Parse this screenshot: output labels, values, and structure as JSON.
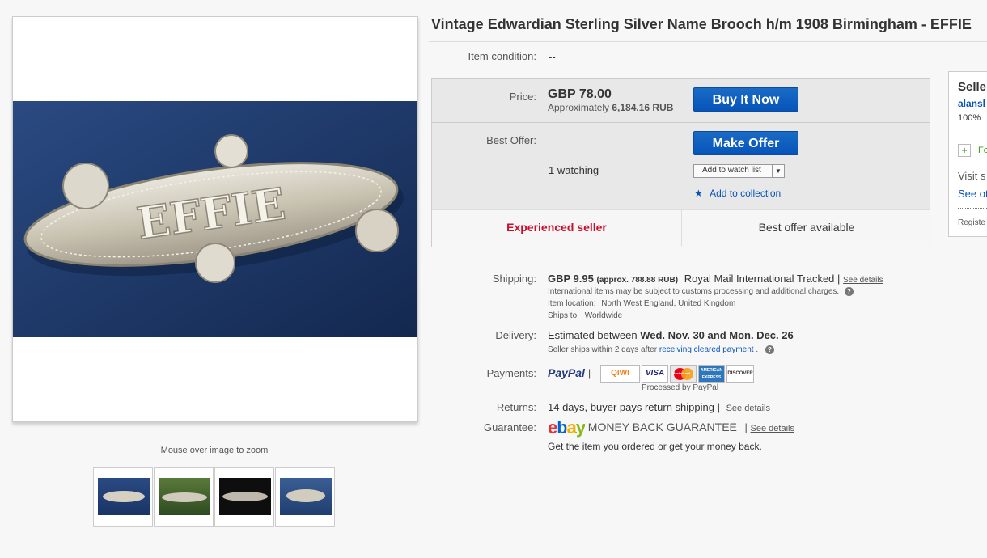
{
  "listing": {
    "title": "Vintage Edwardian Sterling Silver Name Brooch h/m 1908 Birmingham - EFFIE",
    "photo_engraving": "EFFIE",
    "zoom_hint": "Mouse over image to zoom"
  },
  "thumbnails": [
    {
      "name": "brooch front view"
    },
    {
      "name": "brooch in hand"
    },
    {
      "name": "brooch on black"
    },
    {
      "name": "brooch on blue"
    }
  ],
  "item_condition": {
    "label": "Item condition:",
    "value": "--"
  },
  "price": {
    "label": "Price:",
    "amount": "GBP 78.00",
    "approx_prefix": "Approximately",
    "approx_value": "6,184.16 RUB",
    "buy_button": "Buy It Now"
  },
  "best_offer": {
    "label": "Best Offer:",
    "button": "Make Offer",
    "watching": "1 watching",
    "watch_list": "Add to watch list",
    "add_collection": "Add to collection"
  },
  "badges": {
    "left": "Experienced seller",
    "right": "Best offer available"
  },
  "shipping": {
    "label": "Shipping:",
    "amount": "GBP 9.95",
    "approx": "(approx. 788.88 RUB)",
    "service": "Royal Mail International Tracked",
    "sep": "|",
    "details_link": "See details",
    "customs_note": "International items may be subject to customs processing and additional charges.",
    "location_label": "Item location:",
    "location_value": "North West England, United Kingdom",
    "ships_label": "Ships to:",
    "ships_value": "Worldwide"
  },
  "delivery": {
    "label": "Delivery:",
    "prefix": "Estimated between",
    "dates": "Wed. Nov. 30 and Mon. Dec. 26",
    "note_prefix": "Seller ships within 2 days after",
    "note_link": "receiving cleared payment",
    "note_suffix": "."
  },
  "payments": {
    "label": "Payments:",
    "paypal": "PayPal",
    "sep": "|",
    "logos": [
      "QIWI",
      "VISA",
      "MasterCard",
      "AMERICAN EXPRESS",
      "DISCOVER"
    ],
    "processed": "Processed by PayPal"
  },
  "returns": {
    "label": "Returns:",
    "text": "14 days, buyer pays return shipping |",
    "link": "See details"
  },
  "guarantee": {
    "label": "Guarantee:",
    "brand": "ebay",
    "brand_suffix": "MONEY BACK GUARANTEE",
    "sep": "|",
    "link": "See details",
    "note": "Get the item you ordered or get your money back."
  },
  "seller": {
    "heading": "Selle",
    "name": "alansl",
    "feedback": "100%",
    "follow": "Fo",
    "visit": "Visit s",
    "see_other": "See ot",
    "registered": "Registe"
  },
  "colors": {
    "accent_blue": "#0654ba",
    "experienced_red": "#c8102e",
    "follow_green": "#3a9b1b"
  }
}
